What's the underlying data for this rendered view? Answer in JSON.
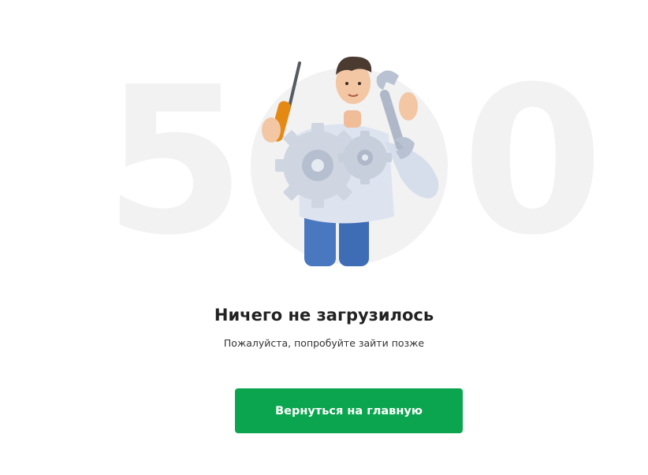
{
  "error": {
    "code_digits": [
      "5",
      "0",
      "0"
    ],
    "title": "Ничего не загрузилось",
    "subtitle": "Пожалуйста, попробуйте зайти позже"
  },
  "actions": {
    "home_button_label": "Вернуться на главную"
  },
  "illustration": {
    "icon_name": "mechanic-with-gears-illustration"
  },
  "colors": {
    "background": "#ffffff",
    "code_digits": "#f2f2f2",
    "button": "#0ca54f",
    "button_text": "#ffffff",
    "title_text": "#222222"
  }
}
